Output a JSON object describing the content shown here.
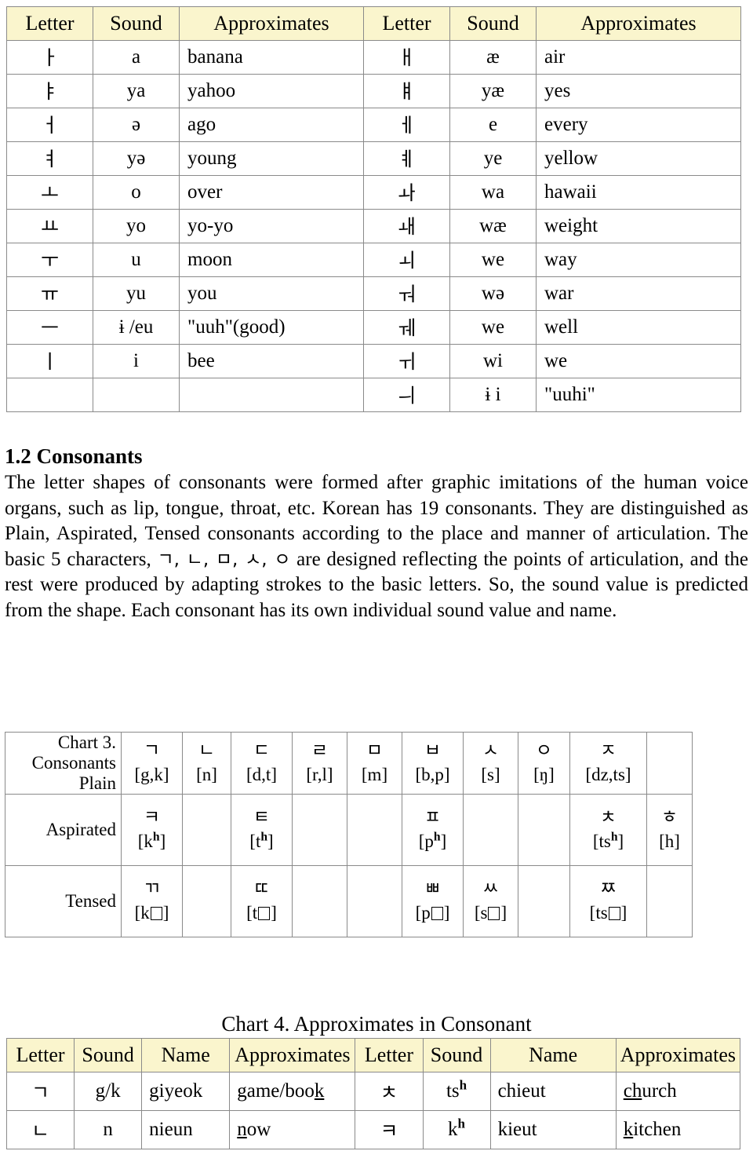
{
  "colors": {
    "header_fill": "#faf5cd",
    "border": "#8a8a8a",
    "text": "#000000"
  },
  "vowel_table": {
    "headers": [
      "Letter",
      "Sound",
      "Approximates",
      "Letter",
      "Sound",
      "Approximates"
    ],
    "rows": [
      {
        "letter_l": "ㅏ",
        "sound_l": "a",
        "approx_l": "banana",
        "letter_r": "ㅐ",
        "sound_r": "æ",
        "approx_r": "air"
      },
      {
        "letter_l": "ㅑ",
        "sound_l": "ya",
        "approx_l": "yahoo",
        "letter_r": "ㅒ",
        "sound_r": "yæ",
        "approx_r": "yes"
      },
      {
        "letter_l": "ㅓ",
        "sound_l": "ə",
        "approx_l": "ago",
        "letter_r": "ㅔ",
        "sound_r": "e",
        "approx_r": "every"
      },
      {
        "letter_l": "ㅕ",
        "sound_l": "yə",
        "approx_l": "young",
        "letter_r": "ㅖ",
        "sound_r": "ye",
        "approx_r": "yellow"
      },
      {
        "letter_l": "ㅗ",
        "sound_l": "o",
        "approx_l": "over",
        "letter_r": "ㅘ",
        "sound_r": "wa",
        "approx_r": "hawaii"
      },
      {
        "letter_l": "ㅛ",
        "sound_l": "yo",
        "approx_l": "yo-yo",
        "letter_r": "ㅙ",
        "sound_r": "wæ",
        "approx_r": "weight"
      },
      {
        "letter_l": "ㅜ",
        "sound_l": "u",
        "approx_l": "moon",
        "letter_r": "ㅚ",
        "sound_r": "we",
        "approx_r": "way"
      },
      {
        "letter_l": "ㅠ",
        "sound_l": "yu",
        "approx_l": "you",
        "letter_r": "ㅝ",
        "sound_r": "wə",
        "approx_r": "war"
      },
      {
        "letter_l": "ㅡ",
        "sound_l": "ɨ /eu",
        "approx_l": "\"uuh\"(good)",
        "letter_r": "ㅞ",
        "sound_r": "we",
        "approx_r": "well"
      },
      {
        "letter_l": "ㅣ",
        "sound_l": "i",
        "approx_l": "bee",
        "letter_r": "ㅟ",
        "sound_r": "wi",
        "approx_r": "we"
      },
      {
        "letter_l": "",
        "sound_l": "",
        "approx_l": "",
        "letter_r": "ㅢ",
        "sound_r": "ɨ i",
        "approx_r": "\"uuhi\""
      }
    ]
  },
  "section": {
    "heading": "1.2 Consonants",
    "body_part1": "The letter shapes of consonants were formed after graphic imitations of the human voice organs, such as lip, tongue, throat, etc. Korean has 19 consonants. They are distinguished as Plain, Aspirated, Tensed consonants according to the place and manner of articulation. The basic 5 characters, ",
    "basic_chars": "ㄱ, ㄴ, ㅁ, ㅅ, ㅇ",
    "body_part2": " are designed reflecting the points of articulation, and the rest were produced by adapting strokes to the basic letters. So, the sound value is predicted from the shape. Each consonant has its own individual sound value and name."
  },
  "consonant_table": {
    "row_labels": [
      "Chart 3.\nConsonants\nPlain",
      "Aspirated",
      "Tensed"
    ],
    "rows": [
      {
        "label": "Chart 3.\nConsonants\nPlain",
        "cells": [
          {
            "glyph": "ㄱ",
            "ipa": "[g,k]"
          },
          {
            "glyph": "ㄴ",
            "ipa": "[n]"
          },
          {
            "glyph": "ㄷ",
            "ipa": "[d,t]"
          },
          {
            "glyph": "ㄹ",
            "ipa": "[r,l]"
          },
          {
            "glyph": "ㅁ",
            "ipa": "[m]"
          },
          {
            "glyph": "ㅂ",
            "ipa": "[b,p]"
          },
          {
            "glyph": "ㅅ",
            "ipa": "[s]"
          },
          {
            "glyph": "ㅇ",
            "ipa": "[ŋ]"
          },
          {
            "glyph": "ㅈ",
            "ipa": "[dz,ts]"
          },
          {
            "glyph": "",
            "ipa": ""
          }
        ]
      },
      {
        "label": "Aspirated",
        "cells": [
          {
            "glyph": "ㅋ",
            "ipa": "[kʰ]"
          },
          {
            "glyph": "",
            "ipa": ""
          },
          {
            "glyph": "ㅌ",
            "ipa": "[tʰ]"
          },
          {
            "glyph": "",
            "ipa": ""
          },
          {
            "glyph": "",
            "ipa": ""
          },
          {
            "glyph": "ㅍ",
            "ipa": "[pʰ]"
          },
          {
            "glyph": "",
            "ipa": ""
          },
          {
            "glyph": "",
            "ipa": ""
          },
          {
            "glyph": "ㅊ",
            "ipa": "[tsʰ]"
          },
          {
            "glyph": "ㅎ",
            "ipa": "[h]"
          }
        ]
      },
      {
        "label": "Tensed",
        "cells": [
          {
            "glyph": "ㄲ",
            "ipa": "[k□]"
          },
          {
            "glyph": "",
            "ipa": ""
          },
          {
            "glyph": "ㄸ",
            "ipa": "[t□]"
          },
          {
            "glyph": "",
            "ipa": ""
          },
          {
            "glyph": "",
            "ipa": ""
          },
          {
            "glyph": "ㅃ",
            "ipa": "[p□]"
          },
          {
            "glyph": "ㅆ",
            "ipa": "[s□]"
          },
          {
            "glyph": "",
            "ipa": ""
          },
          {
            "glyph": "ㅉ",
            "ipa": "[ts□]"
          },
          {
            "glyph": "",
            "ipa": ""
          }
        ]
      }
    ]
  },
  "chart4": {
    "caption": "Chart 4. Approximates in Consonant",
    "headers": [
      "Letter",
      "Sound",
      "Name",
      "Approximates",
      "Letter",
      "Sound",
      "Name",
      "Approximates"
    ],
    "rows": [
      {
        "letter_l": "ㄱ",
        "sound_l": "g/k",
        "name_l": "giyeok",
        "approx_l": [
          {
            "t": "g",
            "u": true
          },
          {
            "t": "ame/boo",
            "u": false
          },
          {
            "t": "k",
            "u": true
          }
        ],
        "letter_r": "ㅊ",
        "sound_r": "tsʰ",
        "name_r": "chieut",
        "approx_r": [
          {
            "t": "ch",
            "u": true
          },
          {
            "t": "urch",
            "u": false
          }
        ]
      },
      {
        "letter_l": "ㄴ",
        "sound_l": "n",
        "name_l": "nieun",
        "approx_l": [
          {
            "t": "n",
            "u": true
          },
          {
            "t": "ow",
            "u": false
          }
        ],
        "letter_r": "ㅋ",
        "sound_r": "kʰ",
        "name_r": "kieut",
        "approx_r": [
          {
            "t": "k",
            "u": true
          },
          {
            "t": "itchen",
            "u": false
          }
        ]
      }
    ]
  }
}
